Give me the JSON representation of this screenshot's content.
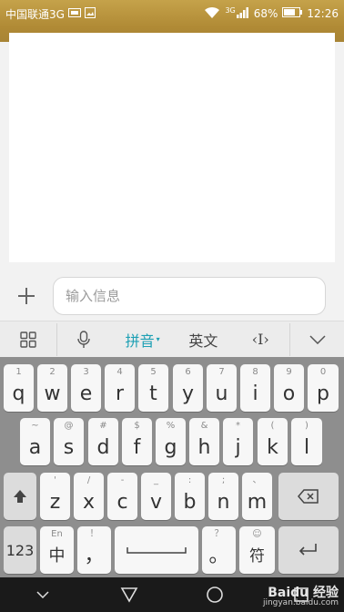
{
  "status": {
    "carrier": "中国联通3G",
    "signal": "3G",
    "battery": "68%",
    "time": "12:26"
  },
  "compose": {
    "add_label": "+",
    "placeholder": "输入信息"
  },
  "ime": {
    "pinyin": "拼音",
    "english": "英文",
    "cursor": "‹I›"
  },
  "keyboard": {
    "row1": [
      {
        "main": "q",
        "sub": "1"
      },
      {
        "main": "w",
        "sub": "2"
      },
      {
        "main": "e",
        "sub": "3"
      },
      {
        "main": "r",
        "sub": "4"
      },
      {
        "main": "t",
        "sub": "5"
      },
      {
        "main": "y",
        "sub": "6"
      },
      {
        "main": "u",
        "sub": "7"
      },
      {
        "main": "i",
        "sub": "8"
      },
      {
        "main": "o",
        "sub": "9"
      },
      {
        "main": "p",
        "sub": "0"
      }
    ],
    "row2": [
      {
        "main": "a",
        "sub": "~"
      },
      {
        "main": "s",
        "sub": "@"
      },
      {
        "main": "d",
        "sub": "#"
      },
      {
        "main": "f",
        "sub": "$"
      },
      {
        "main": "g",
        "sub": "%"
      },
      {
        "main": "h",
        "sub": "&"
      },
      {
        "main": "j",
        "sub": "*"
      },
      {
        "main": "k",
        "sub": "("
      },
      {
        "main": "l",
        "sub": ")"
      }
    ],
    "row3": [
      {
        "main": "z",
        "sub": "'"
      },
      {
        "main": "x",
        "sub": "/"
      },
      {
        "main": "c",
        "sub": "-"
      },
      {
        "main": "v",
        "sub": "_"
      },
      {
        "main": "b",
        "sub": ":"
      },
      {
        "main": "n",
        "sub": ";"
      },
      {
        "main": "m",
        "sub": "、"
      }
    ],
    "num_key": "123",
    "lang_key": "中",
    "lang_sub": "En",
    "comma_key": "，",
    "comma_sub": "！",
    "period_key": "。",
    "period_sub": "？",
    "symbol_key": "符",
    "symbol_sub": "☺"
  },
  "watermark": {
    "brand": "Baidu 经验",
    "url": "jingyan.baidu.com"
  }
}
